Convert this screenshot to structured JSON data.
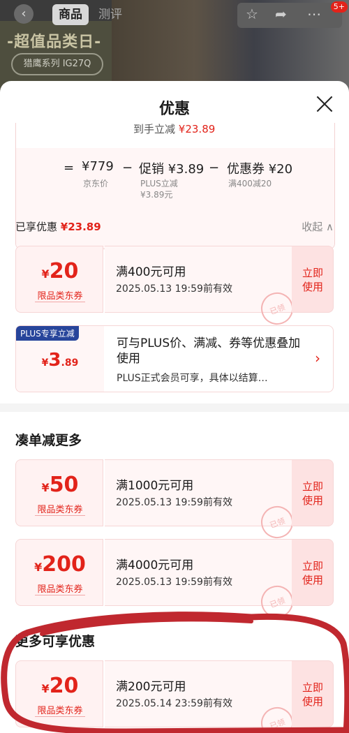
{
  "header": {
    "back_icon": "back-icon",
    "tabs": [
      "商品",
      "测评"
    ],
    "banner_slogan": "-超值品类日-",
    "banner_series": "猎鹰系列 IG27Q",
    "icons": [
      "star-icon",
      "share-icon",
      "more-icon"
    ],
    "badge": "5+"
  },
  "sheet": {
    "title": "优惠",
    "calc_fade": "到手立减",
    "calc_fade_amount": "¥23.89",
    "eq": "=",
    "jd_price": "¥779",
    "jd_price_label": "京东价",
    "minus1": "−",
    "promo": "促销 ¥3.89",
    "promo_sub1": "PLUS立减",
    "promo_sub2": "¥3.89元",
    "minus2": "−",
    "coupon": "优惠券 ¥20",
    "coupon_sub": "满400减20",
    "enjoyed_label": "已享优惠",
    "enjoyed_amount": "¥23.89",
    "collapse": "收起 ∧"
  },
  "coupons_applied": [
    {
      "currency": "¥",
      "amount": "20",
      "type": "限品类东券",
      "condition": "满400元可用",
      "expiry": "2025.05.13 19:59前有效",
      "use": "立即使用",
      "stamp": "已领"
    }
  ],
  "plus": {
    "tag": "PLUS专享立减",
    "currency": "¥",
    "amount": "3",
    "decimals": ".89",
    "text": "可与PLUS价、满减、券等优惠叠加使用",
    "note": "PLUS正式会员可享，具体以结算…",
    "chevron": "›"
  },
  "section_more": "凑单减更多",
  "coupons_more": [
    {
      "currency": "¥",
      "amount": "50",
      "type": "限品类东券",
      "condition": "满1000元可用",
      "expiry": "2025.05.13 19:59前有效",
      "use": "立即使用",
      "stamp": "已领"
    },
    {
      "currency": "¥",
      "amount": "200",
      "type": "限品类东券",
      "condition": "满4000元可用",
      "expiry": "2025.05.13 19:59前有效",
      "use": "立即使用",
      "stamp": "已领"
    }
  ],
  "section_extra": "更多可享优惠",
  "coupons_extra": [
    {
      "currency": "¥",
      "amount": "20",
      "type": "限品类东券",
      "condition": "满200元可用",
      "expiry": "2025.05.14 23:59前有效",
      "use": "立即使用",
      "stamp": "已领"
    }
  ],
  "colors": {
    "accent": "#e2231a",
    "plus": "#27459b",
    "annotation": "#c0282f"
  }
}
